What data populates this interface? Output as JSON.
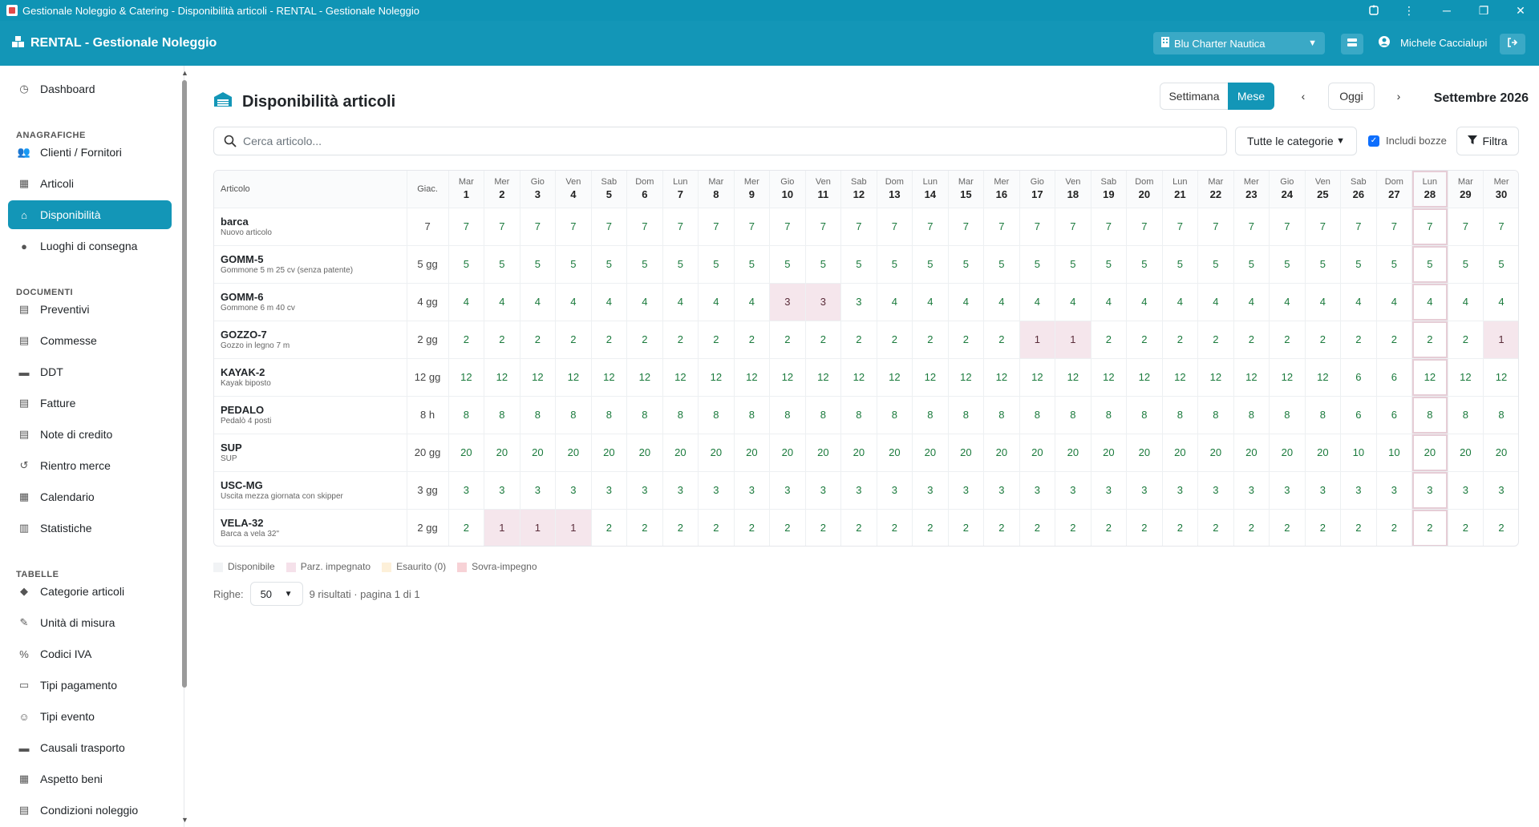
{
  "window": {
    "title": "Gestionale Noleggio & Catering - Disponibilità articoli - RENTAL - Gestionale Noleggio"
  },
  "header": {
    "brand": "RENTAL - Gestionale Noleggio",
    "company": "Blu Charter Nautica",
    "user": "Michele Caccialupi"
  },
  "sidebar": {
    "items": [
      {
        "label": "Dashboard",
        "icon": "dashboard-icon"
      },
      {
        "section": "ANAGRAFICHE"
      },
      {
        "label": "Clienti / Fornitori",
        "icon": "users-icon"
      },
      {
        "label": "Articoli",
        "icon": "boxes-icon"
      },
      {
        "label": "Disponibilità",
        "icon": "warehouse-icon",
        "active": true
      },
      {
        "label": "Luoghi di consegna",
        "icon": "map-pin-icon"
      },
      {
        "section": "DOCUMENTI"
      },
      {
        "label": "Preventivi",
        "icon": "document-icon"
      },
      {
        "label": "Commesse",
        "icon": "document-icon"
      },
      {
        "label": "DDT",
        "icon": "truck-icon"
      },
      {
        "label": "Fatture",
        "icon": "invoice-icon"
      },
      {
        "label": "Note di credito",
        "icon": "credit-note-icon"
      },
      {
        "label": "Rientro merce",
        "icon": "return-icon"
      },
      {
        "label": "Calendario",
        "icon": "calendar-icon"
      },
      {
        "label": "Statistiche",
        "icon": "chart-icon"
      },
      {
        "section": "TABELLE"
      },
      {
        "label": "Categorie articoli",
        "icon": "tags-icon"
      },
      {
        "label": "Unità di misura",
        "icon": "ruler-icon"
      },
      {
        "label": "Codici IVA",
        "icon": "percent-icon"
      },
      {
        "label": "Tipi pagamento",
        "icon": "card-icon"
      },
      {
        "label": "Tipi evento",
        "icon": "people-icon"
      },
      {
        "label": "Causali trasporto",
        "icon": "truck-icon"
      },
      {
        "label": "Aspetto beni",
        "icon": "boxes-icon"
      },
      {
        "label": "Condizioni noleggio",
        "icon": "document-icon"
      }
    ]
  },
  "page": {
    "title": "Disponibilità articoli",
    "view_week": "Settimana",
    "view_month": "Mese",
    "today_button": "Oggi",
    "month_label": "Settembre 2026",
    "search_placeholder": "Cerca articolo...",
    "category_filter": "Tutte le categorie",
    "include_drafts": "Includi bozze",
    "filter_button": "Filtra"
  },
  "grid": {
    "col_article": "Articolo",
    "col_giac": "Giac.",
    "days": [
      [
        "Mar",
        "1"
      ],
      [
        "Mer",
        "2"
      ],
      [
        "Gio",
        "3"
      ],
      [
        "Ven",
        "4"
      ],
      [
        "Sab",
        "5"
      ],
      [
        "Dom",
        "6"
      ],
      [
        "Lun",
        "7"
      ],
      [
        "Mar",
        "8"
      ],
      [
        "Mer",
        "9"
      ],
      [
        "Gio",
        "10"
      ],
      [
        "Ven",
        "11"
      ],
      [
        "Sab",
        "12"
      ],
      [
        "Dom",
        "13"
      ],
      [
        "Lun",
        "14"
      ],
      [
        "Mar",
        "15"
      ],
      [
        "Mer",
        "16"
      ],
      [
        "Gio",
        "17"
      ],
      [
        "Ven",
        "18"
      ],
      [
        "Sab",
        "19"
      ],
      [
        "Dom",
        "20"
      ],
      [
        "Lun",
        "21"
      ],
      [
        "Mar",
        "22"
      ],
      [
        "Mer",
        "23"
      ],
      [
        "Gio",
        "24"
      ],
      [
        "Ven",
        "25"
      ],
      [
        "Sab",
        "26"
      ],
      [
        "Dom",
        "27"
      ],
      [
        "Lun",
        "28"
      ],
      [
        "Mar",
        "29"
      ],
      [
        "Mer",
        "30"
      ]
    ],
    "today_index": 27,
    "rows": [
      {
        "code": "barca",
        "desc": "Nuovo articolo",
        "giac": "7",
        "values": [
          7,
          7,
          7,
          7,
          7,
          7,
          7,
          7,
          7,
          7,
          7,
          7,
          7,
          7,
          7,
          7,
          7,
          7,
          7,
          7,
          7,
          7,
          7,
          7,
          7,
          7,
          7,
          7,
          7,
          7
        ],
        "partial": []
      },
      {
        "code": "GOMM-5",
        "desc": "Gommone 5 m 25 cv (senza patente)",
        "giac": "5 gg",
        "values": [
          5,
          5,
          5,
          5,
          5,
          5,
          5,
          5,
          5,
          5,
          5,
          5,
          5,
          5,
          5,
          5,
          5,
          5,
          5,
          5,
          5,
          5,
          5,
          5,
          5,
          5,
          5,
          5,
          5,
          5
        ],
        "partial": []
      },
      {
        "code": "GOMM-6",
        "desc": "Gommone 6 m 40 cv",
        "giac": "4 gg",
        "values": [
          4,
          4,
          4,
          4,
          4,
          4,
          4,
          4,
          4,
          3,
          3,
          3,
          4,
          4,
          4,
          4,
          4,
          4,
          4,
          4,
          4,
          4,
          4,
          4,
          4,
          4,
          4,
          4,
          4,
          4
        ],
        "partial": [
          9,
          10
        ]
      },
      {
        "code": "GOZZO-7",
        "desc": "Gozzo in legno 7 m",
        "giac": "2 gg",
        "values": [
          2,
          2,
          2,
          2,
          2,
          2,
          2,
          2,
          2,
          2,
          2,
          2,
          2,
          2,
          2,
          2,
          1,
          1,
          2,
          2,
          2,
          2,
          2,
          2,
          2,
          2,
          2,
          2,
          2,
          1
        ],
        "partial": [
          16,
          17,
          29
        ]
      },
      {
        "code": "KAYAK-2",
        "desc": "Kayak biposto",
        "giac": "12 gg",
        "values": [
          12,
          12,
          12,
          12,
          12,
          12,
          12,
          12,
          12,
          12,
          12,
          12,
          12,
          12,
          12,
          12,
          12,
          12,
          12,
          12,
          12,
          12,
          12,
          12,
          12,
          6,
          6,
          12,
          12,
          12
        ],
        "partial": []
      },
      {
        "code": "PEDALO",
        "desc": "Pedalò 4 posti",
        "giac": "8 h",
        "values": [
          8,
          8,
          8,
          8,
          8,
          8,
          8,
          8,
          8,
          8,
          8,
          8,
          8,
          8,
          8,
          8,
          8,
          8,
          8,
          8,
          8,
          8,
          8,
          8,
          8,
          6,
          6,
          8,
          8,
          8
        ],
        "partial": []
      },
      {
        "code": "SUP",
        "desc": "SUP",
        "giac": "20 gg",
        "values": [
          20,
          20,
          20,
          20,
          20,
          20,
          20,
          20,
          20,
          20,
          20,
          20,
          20,
          20,
          20,
          20,
          20,
          20,
          20,
          20,
          20,
          20,
          20,
          20,
          20,
          10,
          10,
          20,
          20,
          20
        ],
        "partial": []
      },
      {
        "code": "USC-MG",
        "desc": "Uscita mezza giornata con skipper",
        "giac": "3 gg",
        "values": [
          3,
          3,
          3,
          3,
          3,
          3,
          3,
          3,
          3,
          3,
          3,
          3,
          3,
          3,
          3,
          3,
          3,
          3,
          3,
          3,
          3,
          3,
          3,
          3,
          3,
          3,
          3,
          3,
          3,
          3
        ],
        "partial": []
      },
      {
        "code": "VELA-32",
        "desc": "Barca a vela 32\"",
        "giac": "2 gg",
        "values": [
          2,
          1,
          1,
          1,
          2,
          2,
          2,
          2,
          2,
          2,
          2,
          2,
          2,
          2,
          2,
          2,
          2,
          2,
          2,
          2,
          2,
          2,
          2,
          2,
          2,
          2,
          2,
          2,
          2,
          2
        ],
        "partial": [
          1,
          2,
          3
        ]
      }
    ]
  },
  "legend": [
    {
      "label": "Disponibile",
      "color": "#f1f3f5"
    },
    {
      "label": "Parz. impegnato",
      "color": "#f5e1ea"
    },
    {
      "label": "Esaurito (0)",
      "color": "#fdf0d9"
    },
    {
      "label": "Sovra-impegno",
      "color": "#f7d2d6"
    }
  ],
  "pager": {
    "rows_label": "Righe:",
    "rows_value": "50",
    "summary": "9 risultati · pagina 1 di 1"
  }
}
